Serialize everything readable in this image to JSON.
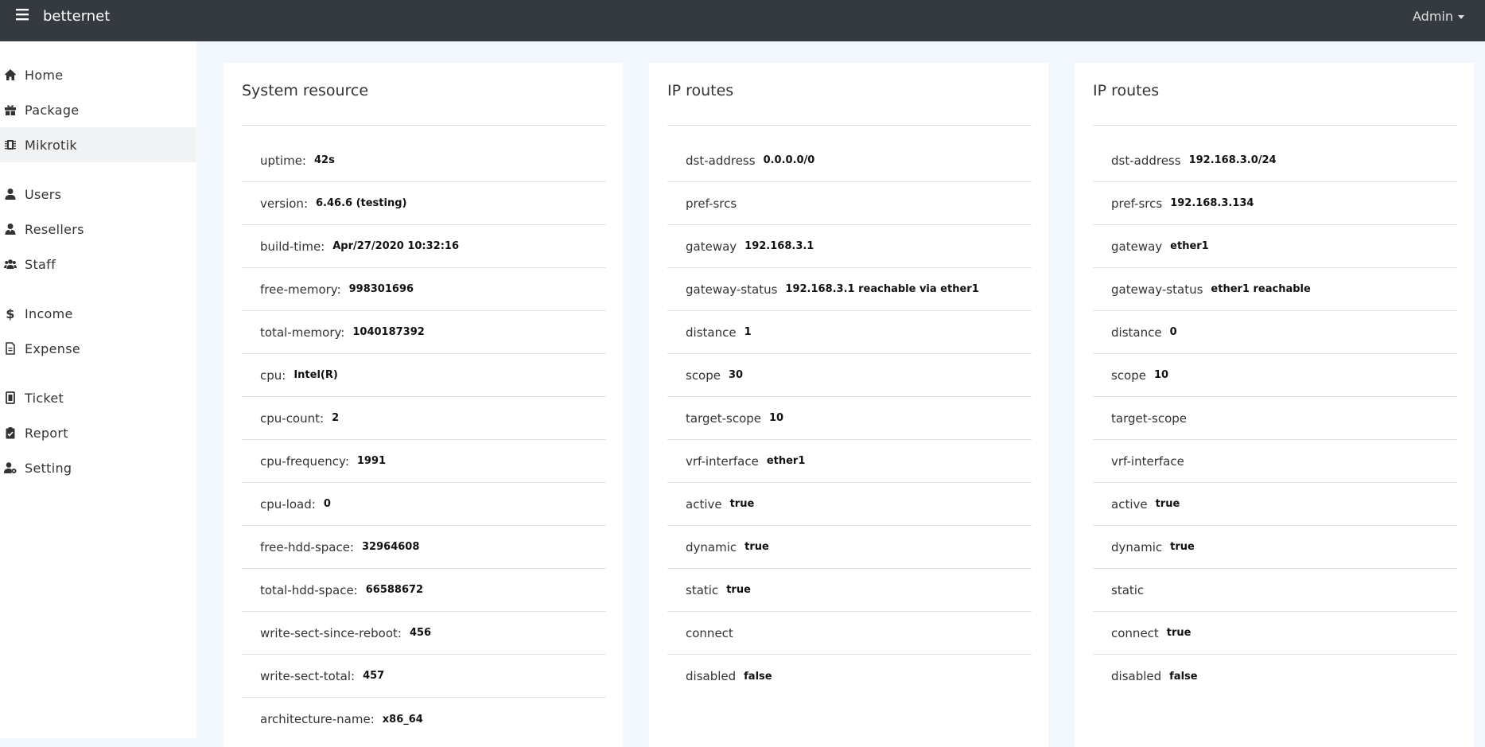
{
  "topbar": {
    "brand": "betternet",
    "user_label": "Admin"
  },
  "sidebar": {
    "items": [
      {
        "label": "Home",
        "icon": "home-icon"
      },
      {
        "label": "Package",
        "icon": "gift-icon"
      },
      {
        "label": "Mikrotik",
        "icon": "chip-icon"
      },
      {
        "label": "Users",
        "icon": "user-icon"
      },
      {
        "label": "Resellers",
        "icon": "user-tie-icon"
      },
      {
        "label": "Staff",
        "icon": "users-icon"
      },
      {
        "label": "Income",
        "icon": "dollar-icon"
      },
      {
        "label": "Expense",
        "icon": "file-icon"
      },
      {
        "label": "Ticket",
        "icon": "ticket-icon"
      },
      {
        "label": "Report",
        "icon": "clipboard-icon"
      },
      {
        "label": "Setting",
        "icon": "user-cog-icon"
      }
    ]
  },
  "cards": [
    {
      "title": "System resource",
      "rows": [
        {
          "key": "uptime:",
          "value": "42s"
        },
        {
          "key": "version:",
          "value": "6.46.6 (testing)"
        },
        {
          "key": "build-time:",
          "value": "Apr/27/2020 10:32:16"
        },
        {
          "key": "free-memory:",
          "value": "998301696"
        },
        {
          "key": "total-memory:",
          "value": "1040187392"
        },
        {
          "key": "cpu:",
          "value": "Intel(R)"
        },
        {
          "key": "cpu-count:",
          "value": "2"
        },
        {
          "key": "cpu-frequency:",
          "value": "1991"
        },
        {
          "key": "cpu-load:",
          "value": "0"
        },
        {
          "key": "free-hdd-space:",
          "value": "32964608"
        },
        {
          "key": "total-hdd-space:",
          "value": "66588672"
        },
        {
          "key": "write-sect-since-reboot:",
          "value": "456"
        },
        {
          "key": "write-sect-total:",
          "value": "457"
        },
        {
          "key": "architecture-name:",
          "value": "x86_64"
        }
      ]
    },
    {
      "title": "IP routes",
      "rows": [
        {
          "key": "dst-address",
          "value": "0.0.0.0/0"
        },
        {
          "key": "pref-srcs",
          "value": ""
        },
        {
          "key": "gateway",
          "value": "192.168.3.1"
        },
        {
          "key": "gateway-status",
          "value": "192.168.3.1 reachable via ether1"
        },
        {
          "key": "distance",
          "value": "1"
        },
        {
          "key": "scope",
          "value": "30"
        },
        {
          "key": "target-scope",
          "value": "10"
        },
        {
          "key": "vrf-interface",
          "value": "ether1"
        },
        {
          "key": "active",
          "value": "true"
        },
        {
          "key": "dynamic",
          "value": "true"
        },
        {
          "key": "static",
          "value": "true"
        },
        {
          "key": "connect",
          "value": ""
        },
        {
          "key": "disabled",
          "value": "false"
        }
      ]
    },
    {
      "title": "IP routes",
      "rows": [
        {
          "key": "dst-address",
          "value": "192.168.3.0/24"
        },
        {
          "key": "pref-srcs",
          "value": "192.168.3.134"
        },
        {
          "key": "gateway",
          "value": "ether1"
        },
        {
          "key": "gateway-status",
          "value": "ether1 reachable"
        },
        {
          "key": "distance",
          "value": "0"
        },
        {
          "key": "scope",
          "value": "10"
        },
        {
          "key": "target-scope",
          "value": ""
        },
        {
          "key": "vrf-interface",
          "value": ""
        },
        {
          "key": "active",
          "value": "true"
        },
        {
          "key": "dynamic",
          "value": "true"
        },
        {
          "key": "static",
          "value": ""
        },
        {
          "key": "connect",
          "value": "true"
        },
        {
          "key": "disabled",
          "value": "false"
        }
      ]
    }
  ]
}
